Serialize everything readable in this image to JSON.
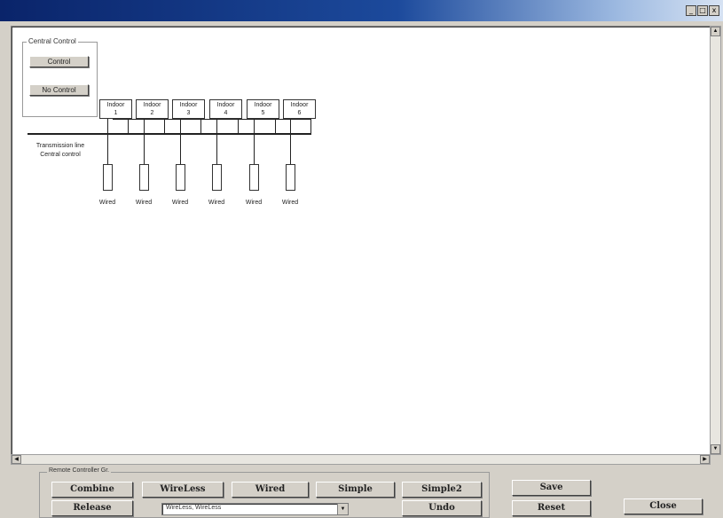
{
  "window": {
    "minimize_glyph": "_",
    "maximize_glyph": "□",
    "close_glyph": "x"
  },
  "central_control": {
    "title": "Central Control",
    "control_button": "Control",
    "no_control_button": "No Control"
  },
  "indoor_units": [
    {
      "name": "Indoor",
      "number": "1"
    },
    {
      "name": "Indoor",
      "number": "2"
    },
    {
      "name": "Indoor",
      "number": "3"
    },
    {
      "name": "Indoor",
      "number": "4"
    },
    {
      "name": "Indoor",
      "number": "5"
    },
    {
      "name": "Indoor",
      "number": "6"
    }
  ],
  "transmission": {
    "line1": "Transmission line",
    "line2": "Central control"
  },
  "remotes": [
    "Wired",
    "Wired",
    "Wired",
    "Wired",
    "Wired",
    "Wired"
  ],
  "bottom_panel": {
    "title": "Remote Controller Gr.",
    "combine": "Combine",
    "wireless": "WireLess",
    "wired": "Wired",
    "simple": "Simple",
    "simple2": "Simple2",
    "release": "Release",
    "combo_value": "WireLess, WireLess",
    "undo": "Undo"
  },
  "actions": {
    "save": "Save",
    "reset": "Reset",
    "close": "Close"
  },
  "colors": {
    "titlebar_start": "#0a246a",
    "titlebar_end": "#d6e2f3",
    "face": "#d4d0c8"
  }
}
